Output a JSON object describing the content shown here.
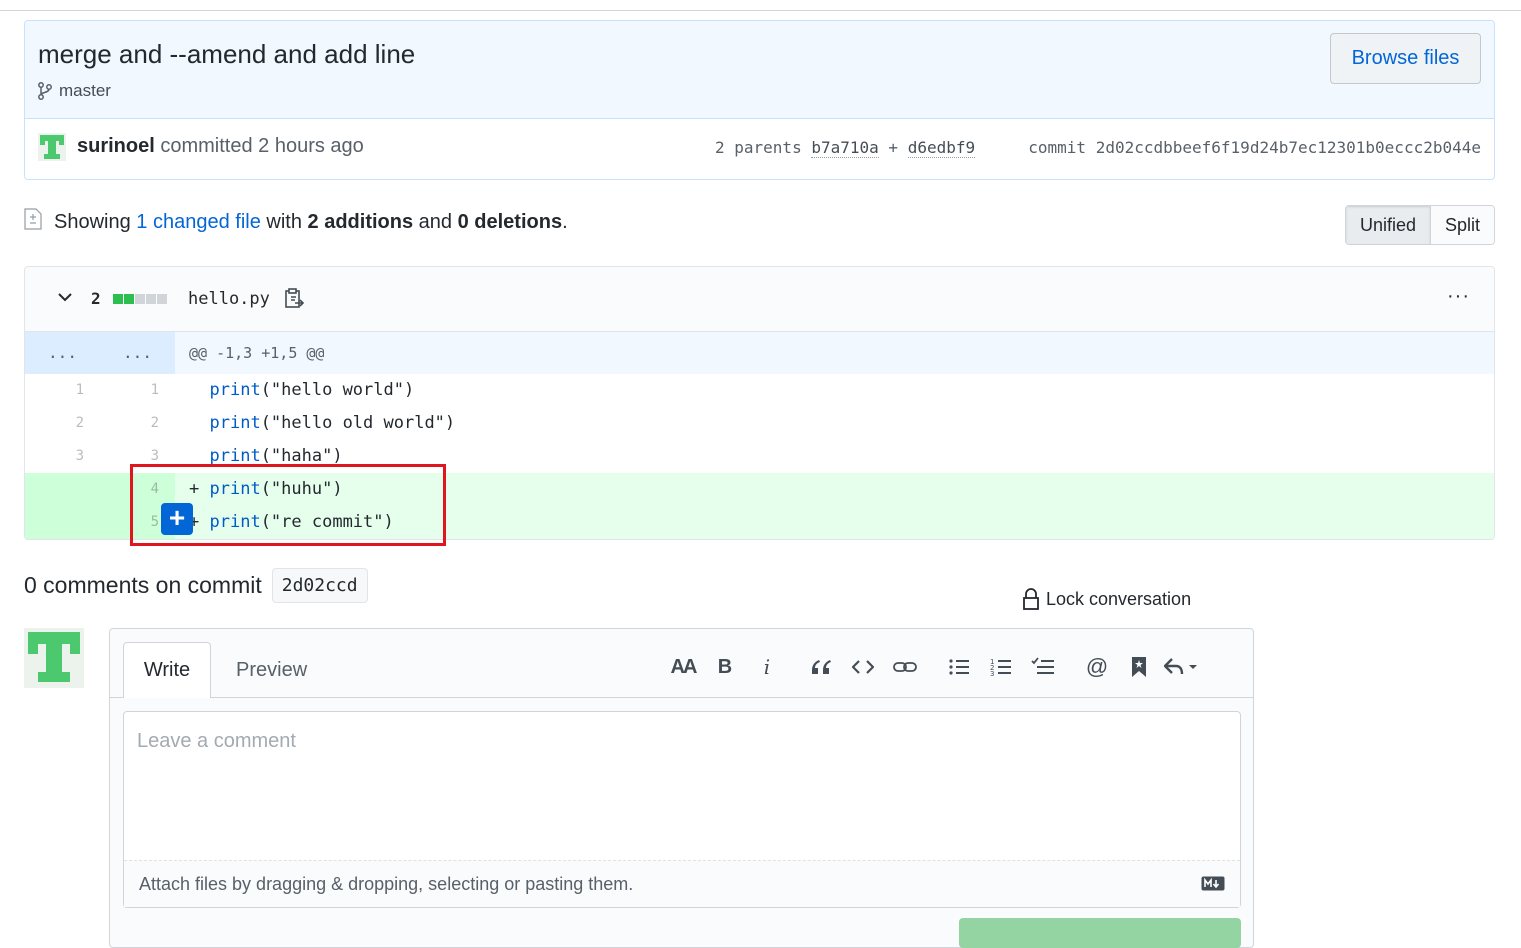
{
  "commit": {
    "title": "merge and --amend and add line",
    "branch": "master",
    "browse_label": "Browse files",
    "author": "surinoel",
    "committed_text": "committed 2 hours ago",
    "parents_label": "2 parents",
    "parent1": "b7a710a",
    "parent_plus": "+",
    "parent2": "d6edbf9",
    "commit_label": "commit",
    "sha": "2d02ccdbbeef6f19d24b7ec12301b0eccc2b044e"
  },
  "summary": {
    "showing": "Showing",
    "changed_link": "1 changed file",
    "with": "with",
    "additions": "2 additions",
    "and": "and",
    "deletions": "0 deletions",
    "period": ".",
    "unified_label": "Unified",
    "split_label": "Split"
  },
  "file": {
    "change_count": "2",
    "name": "hello.py",
    "more": "···",
    "hunk_l": "...",
    "hunk_r": "...",
    "hunk_header": "@@ -1,3 +1,5 @@",
    "lines": [
      {
        "old": "1",
        "new": "1",
        "prefix": " ",
        "fn": "print",
        "rest": "(\"hello world\")"
      },
      {
        "old": "2",
        "new": "2",
        "prefix": " ",
        "fn": "print",
        "rest": "(\"hello old world\")"
      },
      {
        "old": "3",
        "new": "3",
        "prefix": " ",
        "fn": "print",
        "rest": "(\"haha\")"
      },
      {
        "old": "",
        "new": "4",
        "prefix": "+",
        "fn": "print",
        "rest": "(\"huhu\")"
      },
      {
        "old": "",
        "new": "5",
        "prefix": "+",
        "fn": "print",
        "rest": "(\"re commit\")"
      }
    ],
    "add_line_symbol": "+"
  },
  "comments": {
    "heading": "0 comments on commit",
    "short_sha": "2d02ccd",
    "lock_label": "Lock conversation"
  },
  "editor": {
    "tab_write": "Write",
    "tab_preview": "Preview",
    "placeholder": "Leave a comment",
    "attach_text": "Attach files by dragging & dropping, selecting or pasting them.",
    "toolbar": {
      "heading": "AA",
      "bold": "B",
      "italic": "i"
    }
  },
  "colors": {
    "link": "#0366d6",
    "addition_bg": "#e6ffed",
    "highlight_box": "#e0161f",
    "submit": "#94d3a2"
  }
}
